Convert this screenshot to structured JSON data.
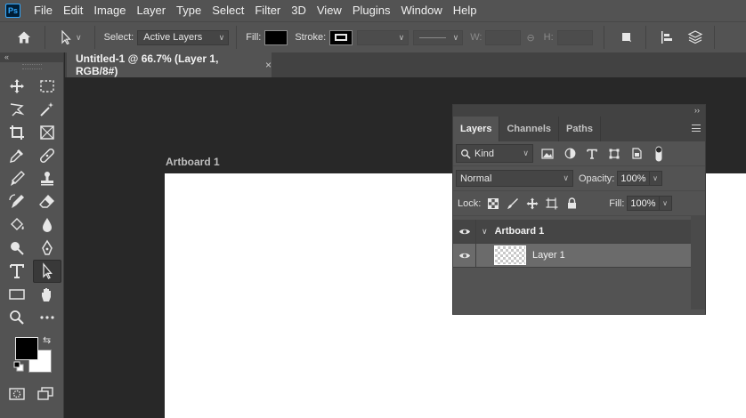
{
  "app": {
    "logo_text": "Ps"
  },
  "menu": [
    "File",
    "Edit",
    "Image",
    "Layer",
    "Type",
    "Select",
    "Filter",
    "3D",
    "View",
    "Plugins",
    "Window",
    "Help"
  ],
  "options_bar": {
    "select_label": "Select:",
    "select_value": "Active Layers",
    "fill_label": "Fill:",
    "stroke_label": "Stroke:",
    "w_label": "W:",
    "h_label": "H:",
    "fill_color": "#000000"
  },
  "toolbar": {
    "collapse_glyph": "«",
    "foreground_color": "#000000",
    "background_color": "#ffffff"
  },
  "document": {
    "tab_title": "Untitled-1 @ 66.7% (Layer 1, RGB/8#)",
    "close_glyph": "×",
    "artboard_label": "Artboard 1"
  },
  "layers_panel": {
    "collapse_glyph": "››",
    "tabs": [
      "Layers",
      "Channels",
      "Paths"
    ],
    "active_tab": "Layers",
    "filter_kind": "Kind",
    "blend_mode": "Normal",
    "opacity_label": "Opacity:",
    "opacity_value": "100%",
    "lock_label": "Lock:",
    "fill_label": "Fill:",
    "fill_value": "100%",
    "group_name": "Artboard 1",
    "layer_name": "Layer 1"
  },
  "colors": {
    "chrome": "#535353",
    "canvas_bg": "#282828",
    "selected_layer": "#6b6b6b"
  }
}
